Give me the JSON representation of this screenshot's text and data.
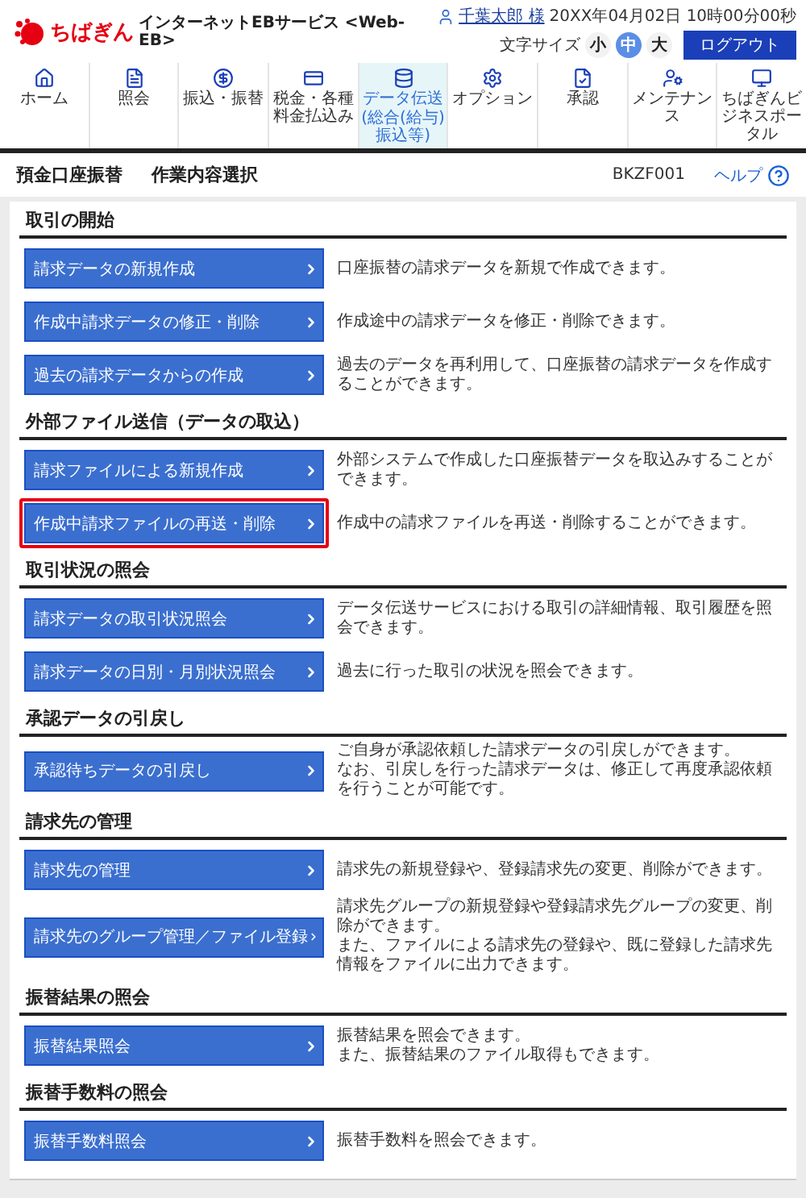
{
  "header": {
    "bank_name": "ちばぎん",
    "service_name": "インターネットEBサービス <Web-EB>",
    "user": "千葉太郎 様",
    "datetime": "20XX年04月02日 10時00分00秒",
    "font_size_label": "文字サイズ",
    "font_sizes": [
      {
        "label": "小",
        "selected": false
      },
      {
        "label": "中",
        "selected": true
      },
      {
        "label": "大",
        "selected": false
      }
    ],
    "logout": "ログアウト"
  },
  "nav": [
    {
      "kind": "home",
      "label": "ホーム",
      "selected": false
    },
    {
      "kind": "document",
      "label": "照会",
      "selected": false
    },
    {
      "kind": "transfer",
      "label": "振込・振替",
      "selected": false
    },
    {
      "kind": "bill",
      "label": "税金・各種料金払込み",
      "selected": false
    },
    {
      "kind": "database",
      "label": "データ伝送",
      "sub": "(総合(給与)振込等)",
      "selected": true
    },
    {
      "kind": "option",
      "label": "オプション",
      "selected": false
    },
    {
      "kind": "approve",
      "label": "承認",
      "selected": false
    },
    {
      "kind": "maintenance",
      "label": "メンテナンス",
      "selected": false
    },
    {
      "kind": "portal",
      "label": "ちばぎんビジネスポータル",
      "selected": false
    }
  ],
  "breadcrumb": {
    "items": [
      "預金口座振替",
      "作業内容選択"
    ],
    "screen_id": "BKZF001",
    "help": "ヘルプ"
  },
  "sections": [
    {
      "title": "取引の開始",
      "rows": [
        {
          "button": "請求データの新規作成",
          "highlighted": false,
          "description": [
            "口座振替の請求データを新規で作成できます。"
          ]
        },
        {
          "button": "作成中請求データの修正・削除",
          "highlighted": false,
          "description": [
            "作成途中の請求データを修正・削除できます。"
          ]
        },
        {
          "button": "過去の請求データからの作成",
          "highlighted": false,
          "description": [
            "過去のデータを再利用して、口座振替の請求データを作成することができます。"
          ]
        }
      ]
    },
    {
      "title": "外部ファイル送信（データの取込）",
      "rows": [
        {
          "button": "請求ファイルによる新規作成",
          "highlighted": false,
          "description": [
            "外部システムで作成した口座振替データを取込みすることができます。"
          ]
        },
        {
          "button": "作成中請求ファイルの再送・削除",
          "highlighted": true,
          "description": [
            "作成中の請求ファイルを再送・削除することができます。"
          ]
        }
      ]
    },
    {
      "title": "取引状況の照会",
      "rows": [
        {
          "button": "請求データの取引状況照会",
          "highlighted": false,
          "description": [
            "データ伝送サービスにおける取引の詳細情報、取引履歴を照会できます。"
          ]
        },
        {
          "button": "請求データの日別・月別状況照会",
          "highlighted": false,
          "description": [
            "過去に行った取引の状況を照会できます。"
          ]
        }
      ]
    },
    {
      "title": "承認データの引戻し",
      "rows": [
        {
          "button": "承認待ちデータの引戻し",
          "highlighted": false,
          "description": [
            "ご自身が承認依頼した請求データの引戻しができます。",
            "なお、引戻しを行った請求データは、修正して再度承認依頼を行うことが可能です。"
          ]
        }
      ]
    },
    {
      "title": "請求先の管理",
      "rows": [
        {
          "button": "請求先の管理",
          "highlighted": false,
          "description": [
            "請求先の新規登録や、登録請求先の変更、削除ができます。"
          ]
        },
        {
          "button": "請求先のグループ管理／ファイル登録",
          "highlighted": false,
          "description": [
            "請求先グループの新規登録や登録請求先グループの変更、削除ができます。",
            "また、ファイルによる請求先の登録や、既に登録した請求先情報をファイルに出力できます。"
          ]
        }
      ]
    },
    {
      "title": "振替結果の照会",
      "rows": [
        {
          "button": "振替結果照会",
          "highlighted": false,
          "description": [
            "振替結果を照会できます。",
            "また、振替結果のファイル取得もできます。"
          ]
        }
      ]
    },
    {
      "title": "振替手数料の照会",
      "rows": [
        {
          "button": "振替手数料照会",
          "highlighted": false,
          "description": [
            "振替手数料を照会できます。"
          ]
        }
      ]
    }
  ]
}
